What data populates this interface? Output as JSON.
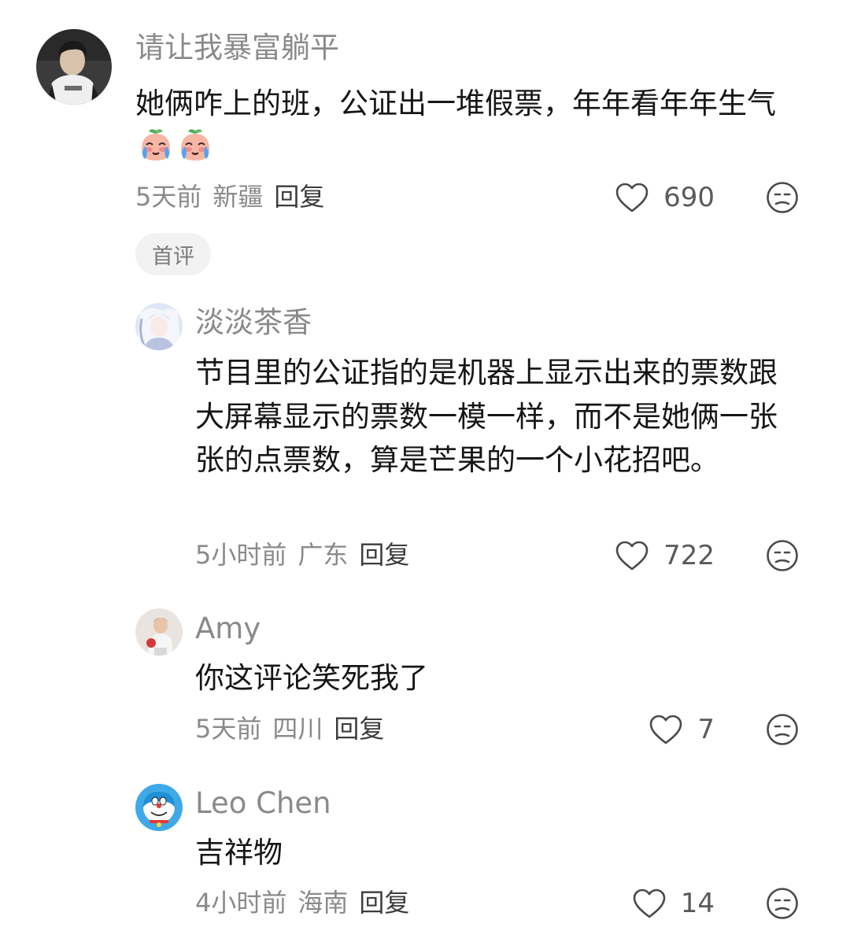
{
  "comments": [
    {
      "username": "请让我暴富躺平",
      "text": "她俩咋上的班，公证出一堆假票，年年看年年生气",
      "emoji": [
        "crying-peach-emoji",
        "crying-peach-emoji"
      ],
      "time": "5天前",
      "region": "新疆",
      "reply": "回复",
      "likes": "690",
      "badge": "首评"
    },
    {
      "username": "淡淡茶香",
      "text": "节目里的公证指的是机器上显示出来的票数跟大屏幕显示的票数一模一样，而不是她俩一张张的点票数，算是芒果的一个小花招吧。",
      "time": "5小时前",
      "region": "广东",
      "reply": "回复",
      "likes": "722"
    },
    {
      "username": "Amy",
      "text": "你这评论笑死我了",
      "time": "5天前",
      "region": "四川",
      "reply": "回复",
      "likes": "7"
    },
    {
      "username": "Leo Chen",
      "text": "吉祥物",
      "time": "4小时前",
      "region": "海南",
      "reply": "回复",
      "likes": "14"
    }
  ],
  "icons": {
    "like": "heart-outline-icon",
    "dislike": "unamused-face-icon"
  },
  "colors": {
    "username": "#8a8a8a",
    "text": "#161616",
    "meta": "#8a8a8a",
    "reply": "#3c3c3c",
    "badge_bg": "#f2f2f2"
  }
}
